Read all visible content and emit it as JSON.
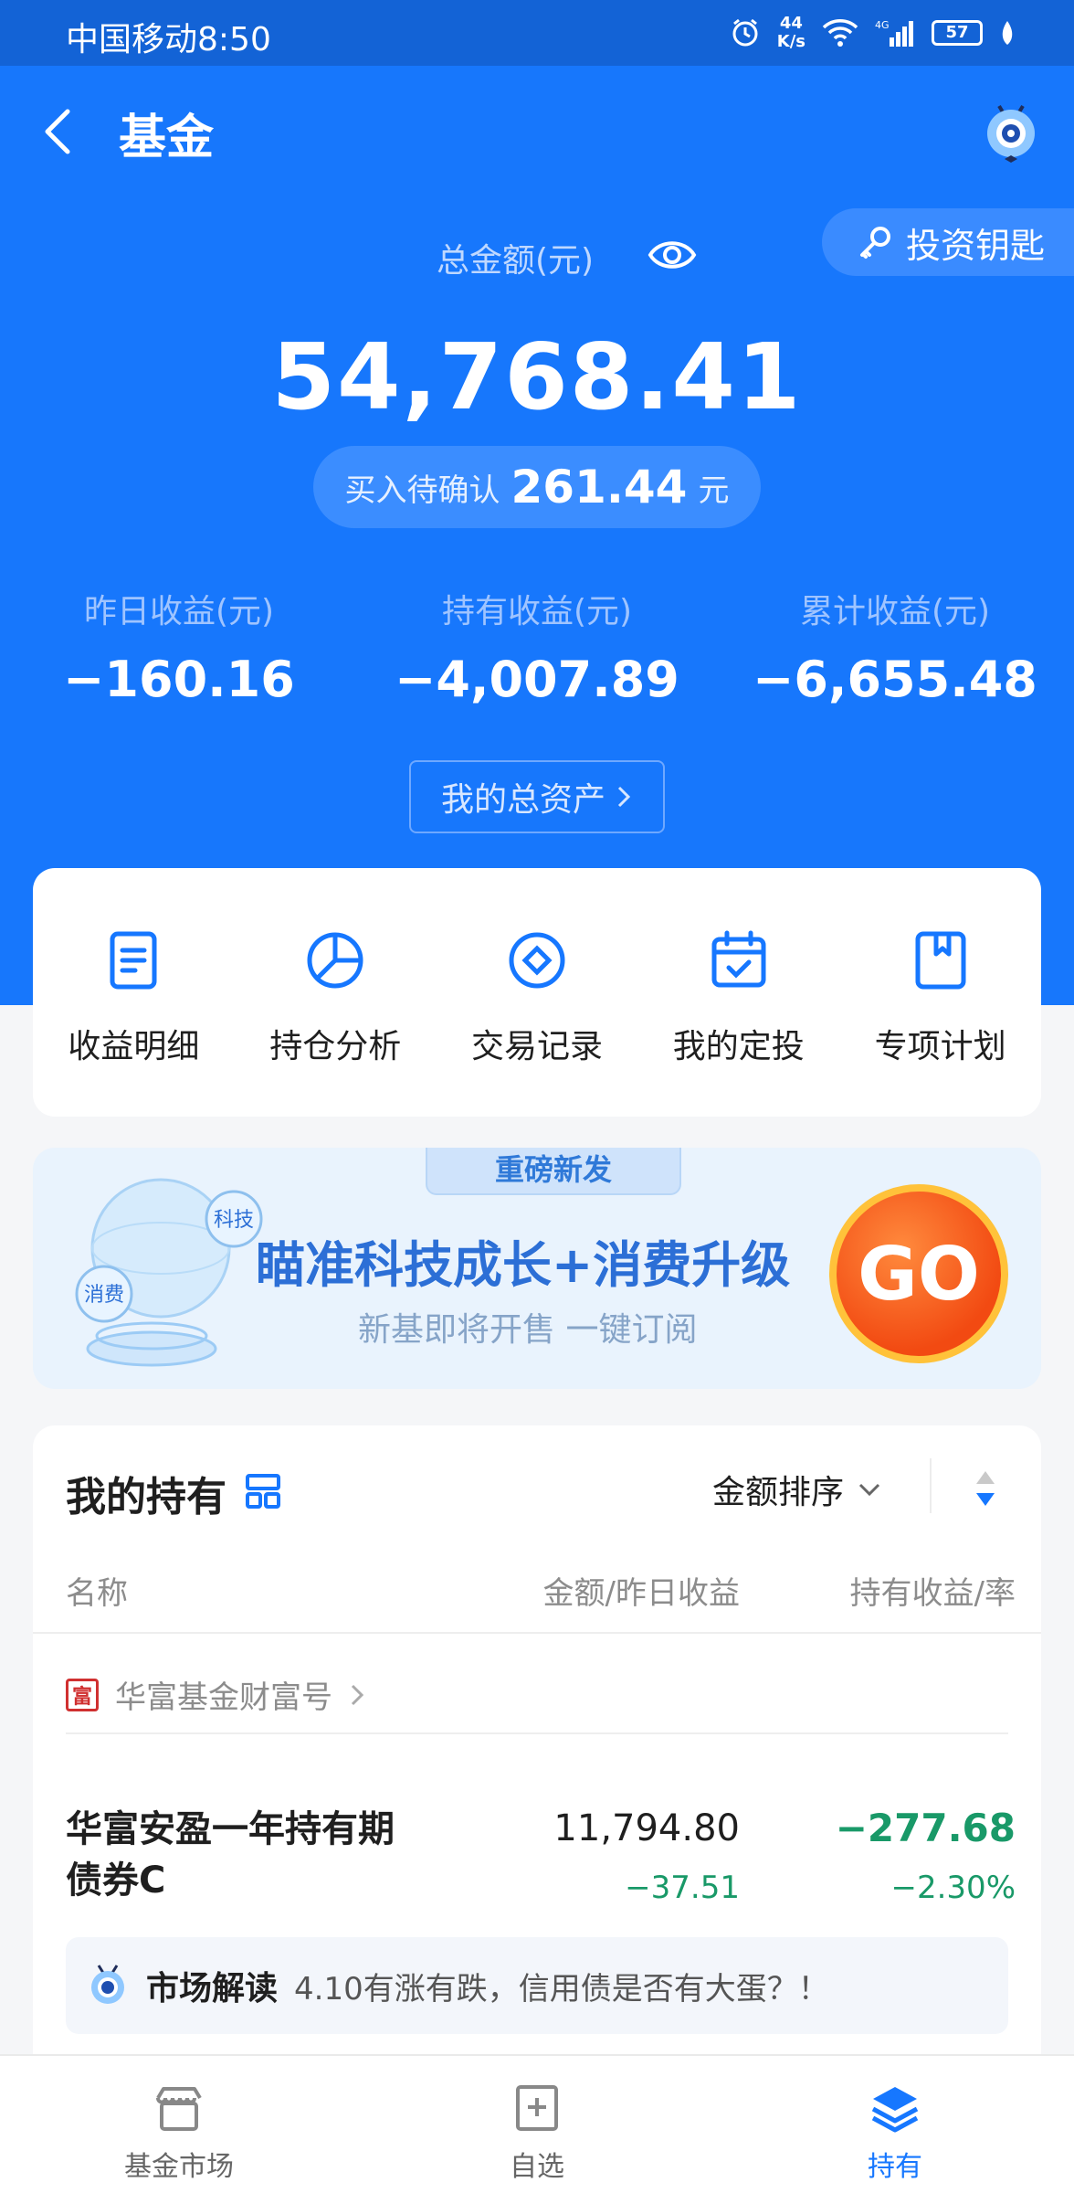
{
  "status_bar": {
    "carrier_time": "中国移动8:50",
    "net_speed_value": "44",
    "net_speed_unit": "K/s",
    "battery": "57",
    "network": "4G"
  },
  "nav": {
    "title": "基金"
  },
  "invest_key": {
    "label": "投资钥匙"
  },
  "summary": {
    "total_label": "总金额(元)",
    "total_amount": "54,768.41",
    "pending_label": "买入待确认",
    "pending_value": "261.44",
    "pending_unit": "元",
    "stats": [
      {
        "label": "昨日收益(元)",
        "value": "−160.16"
      },
      {
        "label": "持有收益(元)",
        "value": "−4,007.89"
      },
      {
        "label": "累计收益(元)",
        "value": "−6,655.48"
      }
    ],
    "assets_button": "我的总资产"
  },
  "quick_actions": [
    {
      "label": "收益明细",
      "icon": "document-icon"
    },
    {
      "label": "持仓分析",
      "icon": "pie-chart-icon"
    },
    {
      "label": "交易记录",
      "icon": "diamond-icon"
    },
    {
      "label": "我的定投",
      "icon": "calendar-check-icon"
    },
    {
      "label": "专项计划",
      "icon": "bookmark-icon"
    }
  ],
  "banner": {
    "tag": "重磅新发",
    "title": "瞄准科技成长+消费升级",
    "subtitle": "新基即将开售 一键订阅",
    "go": "GO",
    "bubble_1": "科技",
    "bubble_2": "消费"
  },
  "holdings": {
    "title": "我的持有",
    "sort_label": "金额排序",
    "columns": {
      "name": "名称",
      "amount": "金额/昨日收益",
      "hold": "持有收益/率"
    },
    "company": {
      "name": "华富基金财富号",
      "logo_char": "富"
    },
    "fund": {
      "name_line1": "华富安盈一年持有期",
      "name_line2": "债券C",
      "amount": "11,794.80",
      "day_profit": "−37.51",
      "hold_profit": "−277.68",
      "hold_rate": "−2.30%"
    },
    "market": {
      "title": "市场解读",
      "content": "4.10有涨有跌，信用债是否有大蛋？！"
    }
  },
  "colors": {
    "brand_blue": "#1777fc",
    "loss_green": "#199968"
  },
  "tabbar": [
    {
      "label": "基金市场",
      "icon": "market-icon",
      "active": false
    },
    {
      "label": "自选",
      "icon": "add-favorite-icon",
      "active": false
    },
    {
      "label": "持有",
      "icon": "layers-icon",
      "active": true
    }
  ]
}
